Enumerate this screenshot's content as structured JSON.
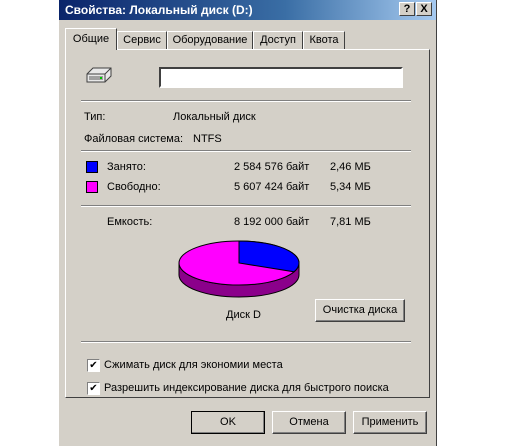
{
  "window": {
    "title": "Свойства: Локальный диск (D:)"
  },
  "titlebar_buttons": {
    "help": "?",
    "close": "X"
  },
  "tabs": [
    {
      "label": "Общие",
      "active": true
    },
    {
      "label": "Сервис"
    },
    {
      "label": "Оборудование"
    },
    {
      "label": "Доступ"
    },
    {
      "label": "Квота"
    }
  ],
  "general": {
    "drive_name_value": "",
    "type_label": "Тип:",
    "type_value": "Локальный диск",
    "fs_label": "Файловая система:",
    "fs_value": "NTFS",
    "used_label": "Занято:",
    "used_bytes": "2 584 576 байт",
    "used_size": "2,46 МБ",
    "free_label": "Свободно:",
    "free_bytes": "5 607 424 байт",
    "free_size": "5,34 МБ",
    "capacity_label": "Емкость:",
    "capacity_bytes": "8 192 000 байт",
    "capacity_size": "7,81 МБ",
    "disk_label": "Диск D",
    "cleanup_button": "Очистка диска",
    "compress_label": "Сжимать диск для экономии места",
    "compress_checked": true,
    "index_label": "Разрешить индексирование диска для быстрого поиска",
    "index_checked": true
  },
  "colors": {
    "used": "#0000ff",
    "free": "#ff00ff"
  },
  "usage": {
    "used_fraction": 0.3155
  },
  "footer": {
    "ok": "OK",
    "cancel": "Отмена",
    "apply": "Применить"
  }
}
